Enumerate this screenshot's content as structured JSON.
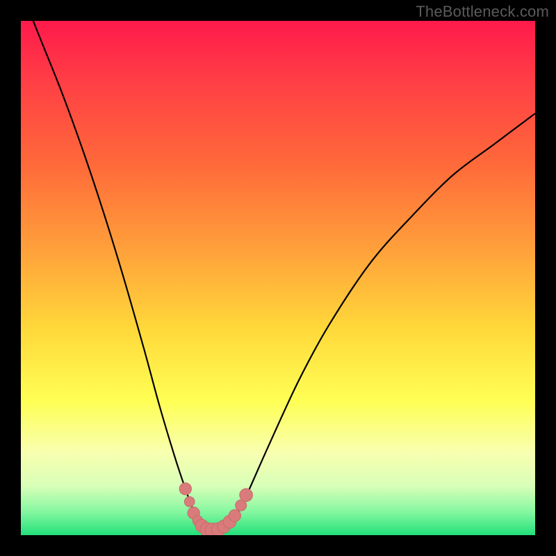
{
  "watermark": "TheBottleneck.com",
  "colors": {
    "frame": "#000000",
    "curve": "#000000",
    "marker_fill": "#d97b7b",
    "marker_stroke": "#c96a6a",
    "gradient_stops": [
      {
        "offset": 0.0,
        "color": "#ff1a4b"
      },
      {
        "offset": 0.12,
        "color": "#ff3f45"
      },
      {
        "offset": 0.28,
        "color": "#ff6a3a"
      },
      {
        "offset": 0.45,
        "color": "#ffa23a"
      },
      {
        "offset": 0.6,
        "color": "#ffd93a"
      },
      {
        "offset": 0.74,
        "color": "#ffff55"
      },
      {
        "offset": 0.84,
        "color": "#f8ffb0"
      },
      {
        "offset": 0.905,
        "color": "#d8ffb8"
      },
      {
        "offset": 0.955,
        "color": "#84f7a0"
      },
      {
        "offset": 1.0,
        "color": "#22e07a"
      }
    ]
  },
  "chart_data": {
    "type": "line",
    "title": "",
    "xlabel": "",
    "ylabel": "",
    "xlim": [
      0,
      100
    ],
    "ylim": [
      0,
      100
    ],
    "grid": false,
    "legend": false,
    "series": [
      {
        "name": "bottleneck-curve",
        "x": [
          0,
          4,
          8,
          12,
          16,
          20,
          24,
          27,
          30,
          32,
          33.5,
          35,
          36,
          37,
          38,
          40,
          42,
          44,
          48,
          54,
          60,
          68,
          76,
          84,
          92,
          100
        ],
        "y": [
          106,
          96,
          86,
          75,
          63,
          50,
          36,
          25,
          15,
          9,
          5,
          2.5,
          1.3,
          0.9,
          1.0,
          1.8,
          4,
          8,
          17,
          30,
          41,
          53,
          62,
          70,
          76,
          82
        ]
      }
    ],
    "markers": [
      {
        "x": 32.0,
        "y": 9.0,
        "r": 1.3
      },
      {
        "x": 32.8,
        "y": 6.5,
        "r": 1.1
      },
      {
        "x": 33.6,
        "y": 4.3,
        "r": 1.3
      },
      {
        "x": 34.4,
        "y": 2.8,
        "r": 1.1
      },
      {
        "x": 35.2,
        "y": 1.8,
        "r": 1.4
      },
      {
        "x": 36.2,
        "y": 1.1,
        "r": 1.5
      },
      {
        "x": 37.3,
        "y": 0.9,
        "r": 1.6
      },
      {
        "x": 38.4,
        "y": 1.1,
        "r": 1.5
      },
      {
        "x": 39.5,
        "y": 1.7,
        "r": 1.4
      },
      {
        "x": 40.6,
        "y": 2.6,
        "r": 1.4
      },
      {
        "x": 41.6,
        "y": 3.8,
        "r": 1.3
      },
      {
        "x": 42.8,
        "y": 5.8,
        "r": 1.2
      },
      {
        "x": 43.8,
        "y": 7.8,
        "r": 1.4
      }
    ]
  }
}
